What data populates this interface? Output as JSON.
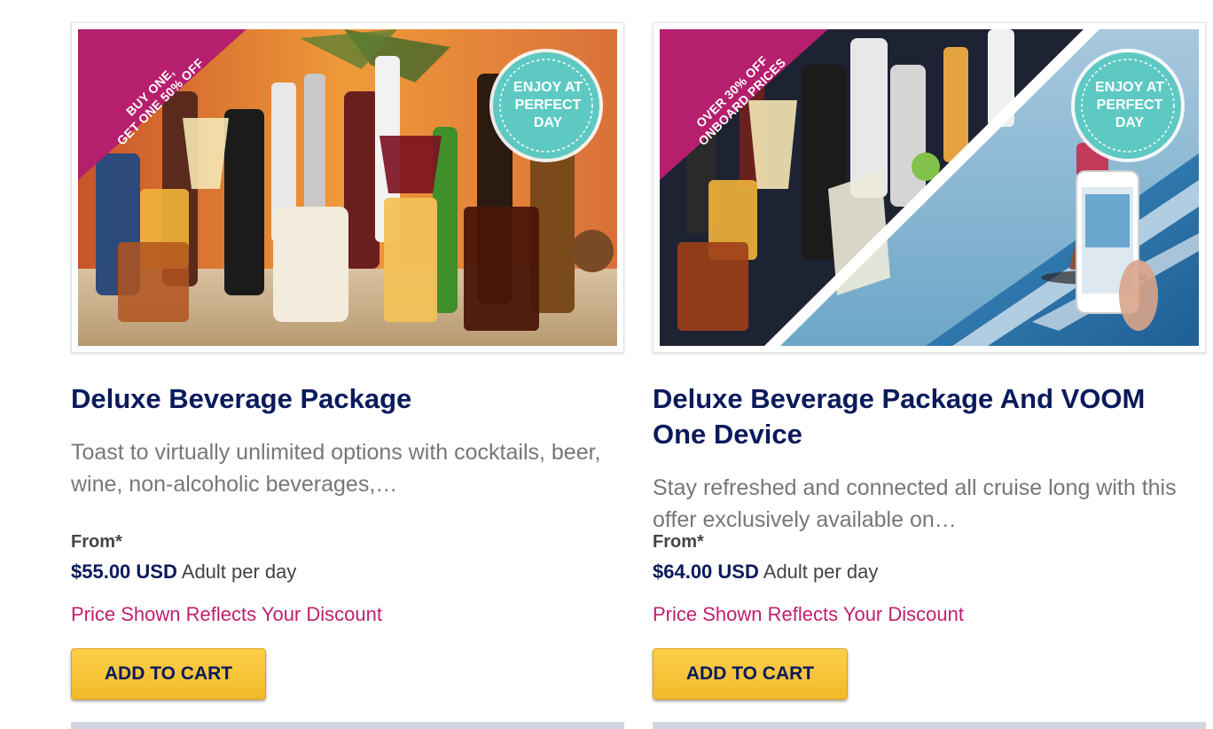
{
  "products": [
    {
      "ribbon": [
        "BUY ONE,",
        "GET ONE 50% OFF"
      ],
      "badge": [
        "ENJOY AT",
        "PERFECT",
        "DAY"
      ],
      "title": "Deluxe Beverage Package",
      "description": "Toast to virtually unlimited options with cocktails, beer, wine, non-alcoholic beverages,…",
      "from_label": "From*",
      "price": "$55.00 USD",
      "price_unit": "Adult per day",
      "discount_note": "Price Shown Reflects Your Discount",
      "button_label": "ADD TO CART"
    },
    {
      "ribbon": [
        "OVER 30% OFF",
        "ONBOARD PRICES"
      ],
      "badge": [
        "ENJOY AT",
        "PERFECT",
        "DAY"
      ],
      "title": "Deluxe Beverage Package And VOOM One Device",
      "description": "Stay refreshed and connected all cruise long with this offer exclusively available on…",
      "from_label": "From*",
      "price": "$64.00 USD",
      "price_unit": "Adult per day",
      "discount_note": "Price Shown Reflects Your Discount",
      "button_label": "ADD TO CART"
    }
  ],
  "colors": {
    "title": "#0a1a5c",
    "ribbon": "#b51f6d",
    "badge": "#5ec9c3",
    "discount": "#c01f6e",
    "button": "#f5c232"
  }
}
